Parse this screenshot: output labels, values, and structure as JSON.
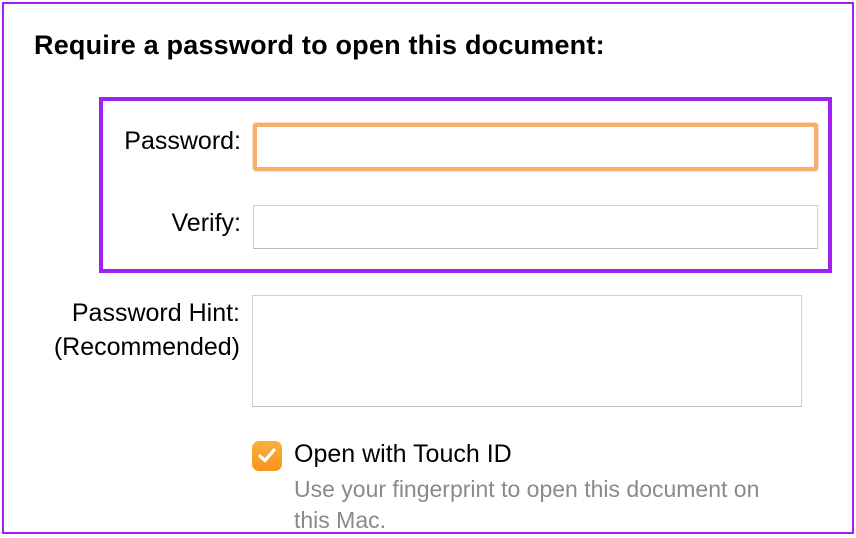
{
  "title": "Require a password to open this document:",
  "fields": {
    "password": {
      "label": "Password:",
      "value": ""
    },
    "verify": {
      "label": "Verify:",
      "value": ""
    },
    "hint": {
      "label_line1": "Password Hint:",
      "label_line2": "(Recommended)",
      "value": ""
    }
  },
  "touch_id": {
    "checked": true,
    "label": "Open with Touch ID",
    "description": "Use your fingerprint to open this document on this Mac."
  },
  "colors": {
    "accent": "#f7931e",
    "highlight_border": "#a020f0",
    "focus_ring": "#f4b06a"
  }
}
